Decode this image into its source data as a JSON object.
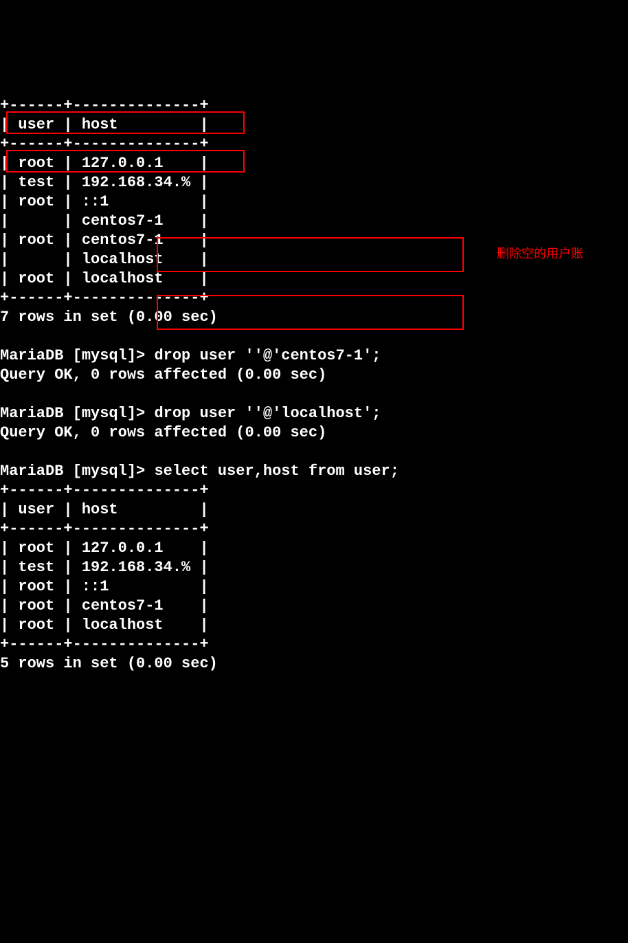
{
  "table1": {
    "top_border": "+------+--------------+",
    "header": "| user | host         |",
    "sep": "+------+--------------+",
    "rows": [
      "| root | 127.0.0.1    |",
      "| test | 192.168.34.% |",
      "| root | ::1          |",
      "|      | centos7-1    |",
      "| root | centos7-1    |",
      "|      | localhost    |",
      "| root | localhost    |"
    ],
    "bottom_border": "+------+--------------+",
    "summary": "7 rows in set (0.00 sec)"
  },
  "cmd1": {
    "prompt": "MariaDB [mysql]> ",
    "command": "drop user ''@'centos7-1';",
    "result": "Query OK, 0 rows affected (0.00 sec)"
  },
  "cmd2": {
    "prompt": "MariaDB [mysql]> ",
    "command": "drop user ''@'localhost';",
    "result": "Query OK, 0 rows affected (0.00 sec)"
  },
  "cmd3": {
    "prompt": "MariaDB [mysql]> ",
    "command": "select user,host from user;"
  },
  "table2": {
    "top_border": "+------+--------------+",
    "header": "| user | host         |",
    "sep": "+------+--------------+",
    "rows": [
      "| root | 127.0.0.1    |",
      "| test | 192.168.34.% |",
      "| root | ::1          |",
      "| root | centos7-1    |",
      "| root | localhost    |"
    ],
    "bottom_border": "+------+--------------+",
    "summary": "5 rows in set (0.00 sec)"
  },
  "annotation": {
    "text": "删除空的用户账"
  }
}
